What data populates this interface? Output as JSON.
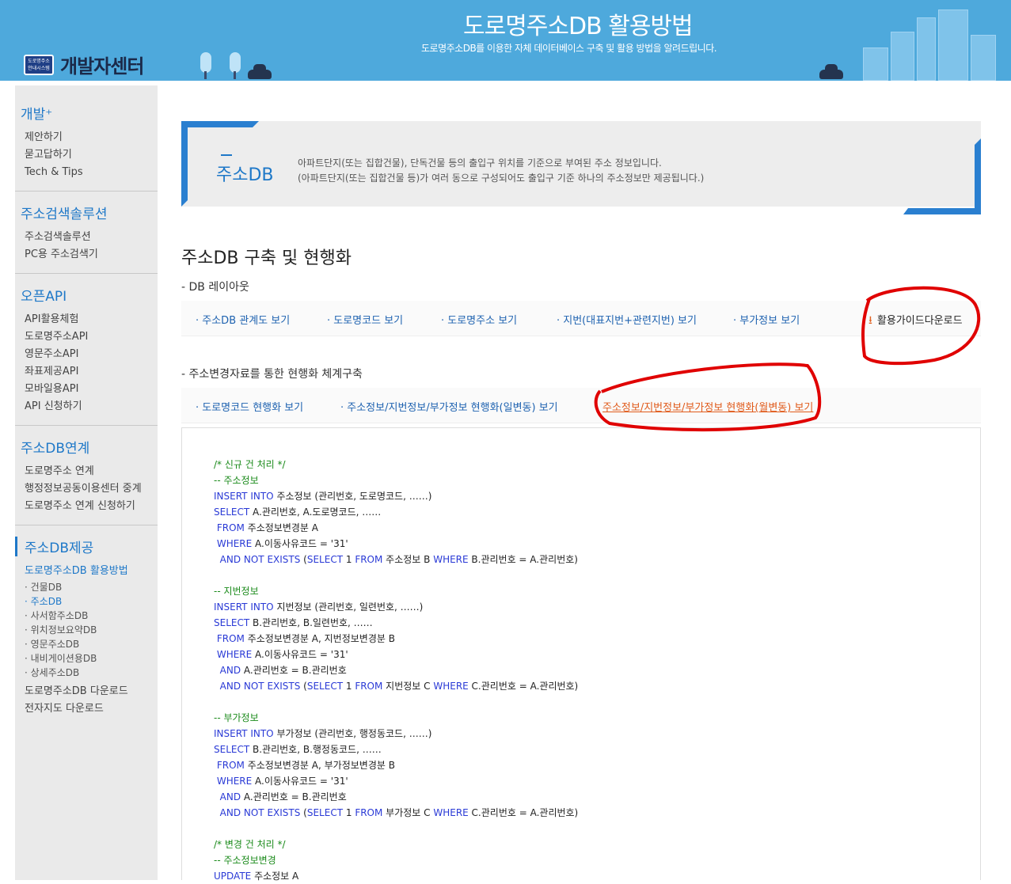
{
  "header": {
    "logo_badge": "도로명주소 안내시스템",
    "logo_text": "개발자센터",
    "title": "도로명주소DB 활용방법",
    "subtitle": "도로명주소DB를 이용한 자체 데이터베이스 구축 및 활용 방법을 알려드립니다."
  },
  "sidebar": {
    "sections": [
      {
        "title": "개발⁺",
        "links": [
          "제안하기",
          "묻고답하기",
          "Tech & Tips"
        ]
      },
      {
        "title": "주소검색솔루션",
        "links": [
          "주소검색솔루션",
          "PC용 주소검색기"
        ]
      },
      {
        "title": "오픈API",
        "links": [
          "API활용체험",
          "도로명주소API",
          "영문주소API",
          "좌표제공API",
          "모바일용API",
          "API 신청하기"
        ]
      },
      {
        "title": "주소DB연계",
        "links": [
          "도로명주소 연계",
          "행정정보공동이용센터 중계",
          "도로명주소 연계 신청하기"
        ]
      }
    ],
    "active_section": {
      "title": "주소DB제공",
      "link1": "도로명주소DB 활용방법",
      "sub": [
        "· 건물DB",
        "· 주소DB",
        "· 사서함주소DB",
        "· 위치정보요약DB",
        "· 영문주소DB",
        "· 내비게이션용DB",
        "· 상세주소DB"
      ],
      "link2": "도로명주소DB 다운로드",
      "link3": "전자지도 다운로드"
    }
  },
  "banner": {
    "title": "주소DB",
    "desc1": "아파트단지(또는 집합건물), 단독건물 등의 출입구 위치를 기준으로 부여된 주소 정보입니다.",
    "desc2": "(아파트단지(또는 집합건물 등)가 여러 동으로 구성되어도 출입구 기준 하나의 주소정보만 제공됩니다.)"
  },
  "main": {
    "title": "주소DB 구축 및 현행화",
    "layout_heading": "- DB 레이아웃",
    "layout_tabs": [
      "· 주소DB 관계도 보기",
      "· 도로명코드 보기",
      "· 도로명주소 보기",
      "· 지번(대표지번+관련지번) 보기",
      "· 부가정보 보기"
    ],
    "download_label": "활용가이드다운로드",
    "update_heading": "- 주소변경자료를 통한 현행화 체계구축",
    "update_tabs": [
      "· 도로명코드 현행화 보기",
      "· 주소정보/지번정보/부가정보 현행화(일변동) 보기",
      "주소정보/지번정보/부가정보 현행화(월변동) 보기"
    ]
  },
  "colors": {
    "accent": "#1e78c8",
    "header_bg": "#4ea9dc",
    "active_tab": "#e05a1a",
    "annotation": "#e00000"
  }
}
